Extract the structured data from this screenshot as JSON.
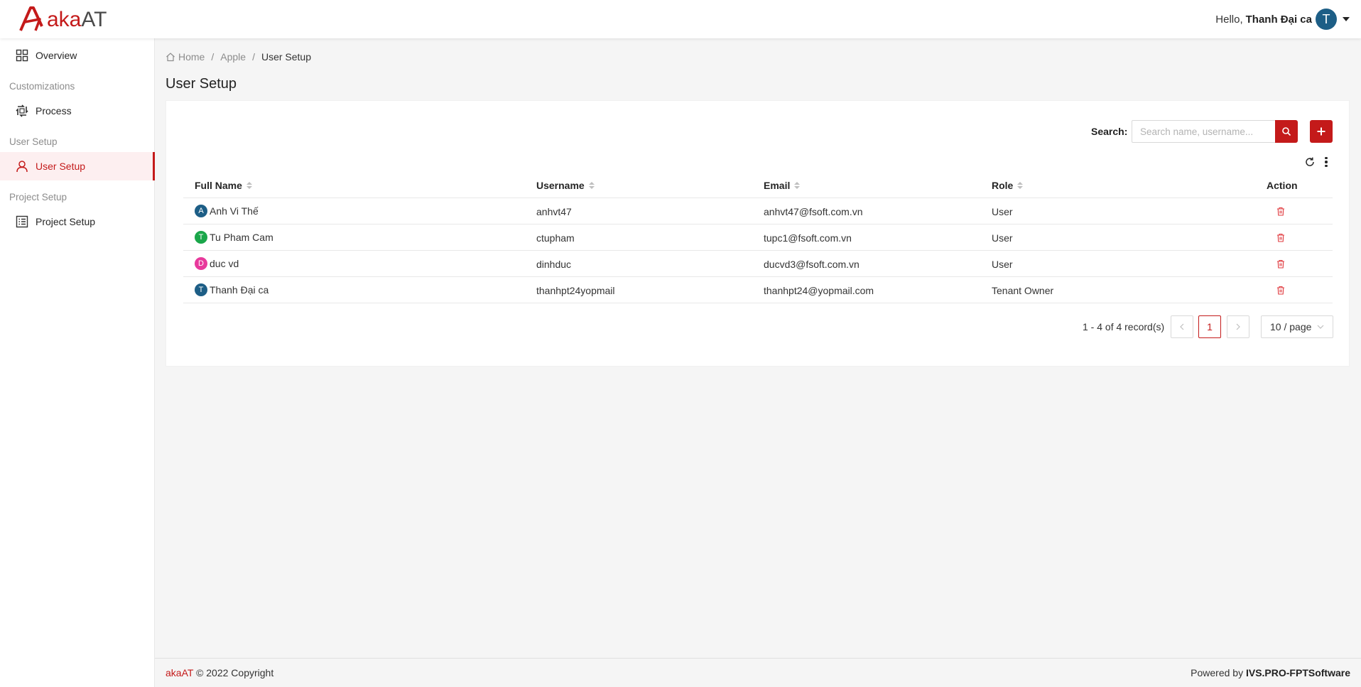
{
  "header": {
    "logo_aka": "aka",
    "logo_at": "AT",
    "greeting": "Hello,",
    "user_name": "Thanh Đại ca",
    "avatar_initial": "T"
  },
  "sidebar": {
    "overview": "Overview",
    "group_customizations": "Customizations",
    "process": "Process",
    "group_user_setup": "User Setup",
    "user_setup": "User Setup",
    "group_project_setup": "Project Setup",
    "project_setup": "Project Setup"
  },
  "breadcrumb": {
    "home": "Home",
    "sep": "/",
    "apple": "Apple",
    "current": "User Setup"
  },
  "page_title": "User Setup",
  "search": {
    "label": "Search:",
    "placeholder": "Search name, username..."
  },
  "table": {
    "columns": [
      "Full Name",
      "Username",
      "Email",
      "Role",
      "Action"
    ],
    "rows": [
      {
        "initial": "A",
        "avatar_color": "#1d5e86",
        "full_name": "Anh Vi Thế",
        "username": "anhvt47",
        "email": "anhvt47@fsoft.com.vn",
        "role": "User"
      },
      {
        "initial": "T",
        "avatar_color": "#1aa64a",
        "full_name": "Tu Pham Cam",
        "username": "ctupham",
        "email": "tupc1@fsoft.com.vn",
        "role": "User"
      },
      {
        "initial": "D",
        "avatar_color": "#e8399c",
        "full_name": "duc vd",
        "username": "dinhduc",
        "email": "ducvd3@fsoft.com.vn",
        "role": "User"
      },
      {
        "initial": "T",
        "avatar_color": "#1d5e86",
        "full_name": "Thanh Đại ca",
        "username": "thanhpt24yopmail",
        "email": "thanhpt24@yopmail.com",
        "role": "Tenant Owner"
      }
    ]
  },
  "pagination": {
    "total": "1 - 4 of 4 record(s)",
    "current_page": "1",
    "page_size": "10 / page"
  },
  "footer": {
    "brand": "akaAT",
    "copyright": "© 2022 Copyright",
    "powered_by": "Powered by",
    "company": "IVS.PRO-FPTSoftware"
  },
  "colors": {
    "accent": "#c41a1a",
    "active_bg": "#fdeff0"
  }
}
